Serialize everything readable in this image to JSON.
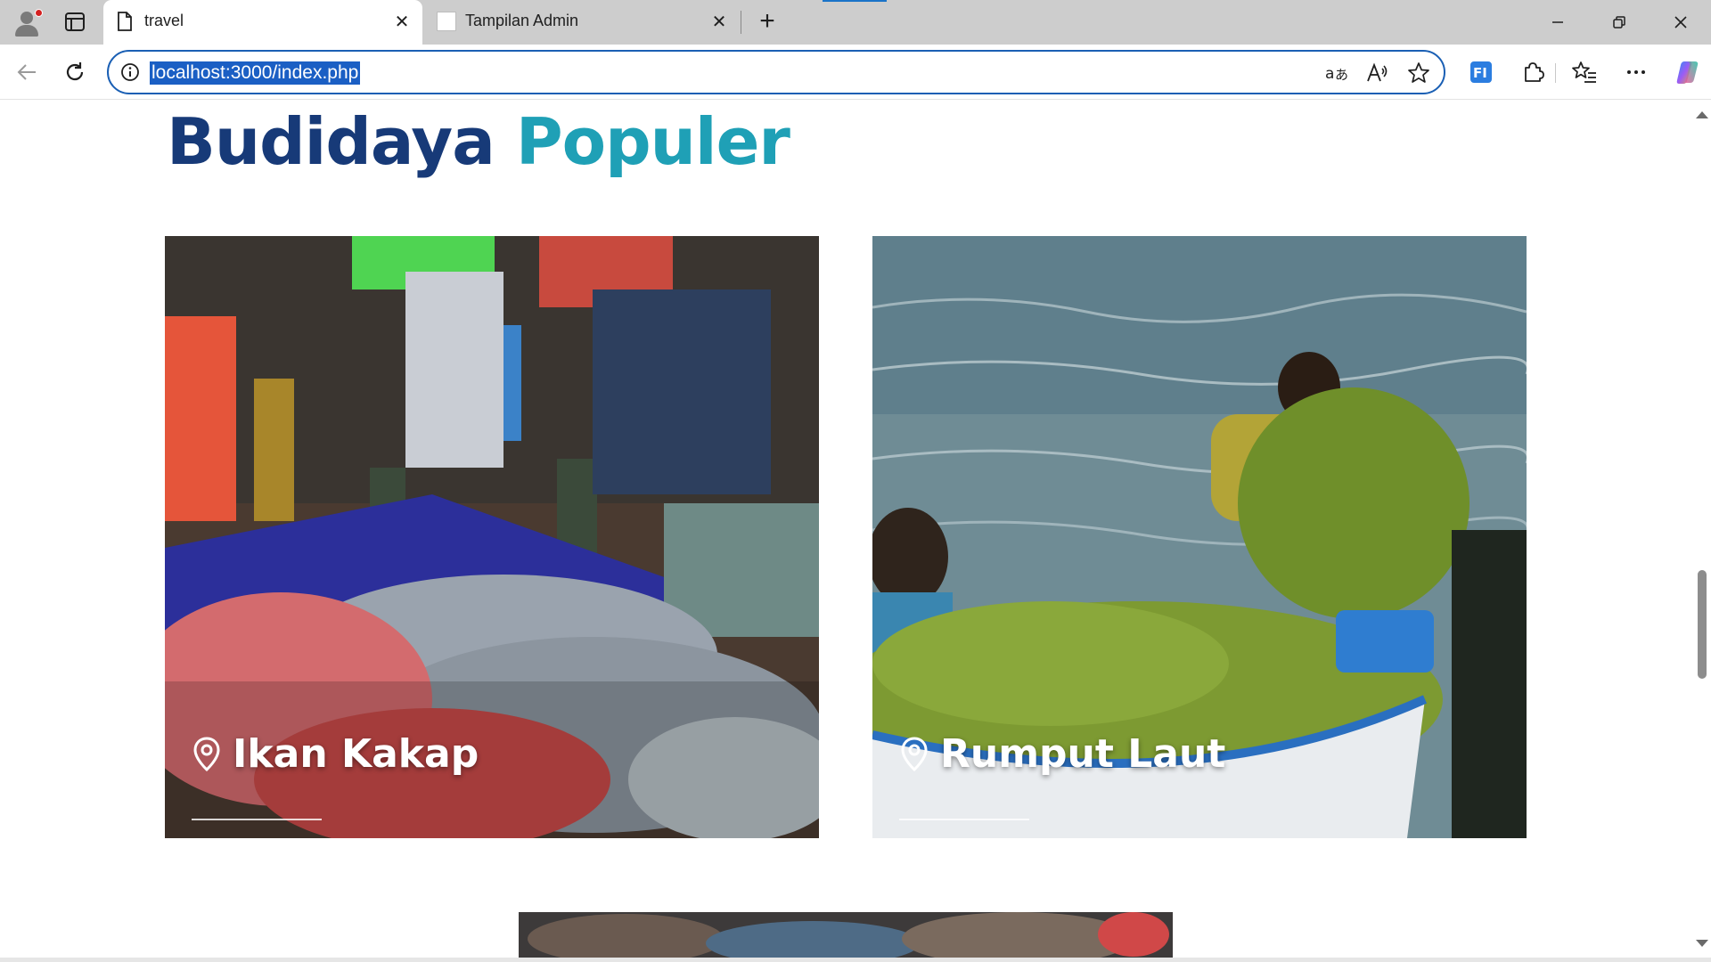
{
  "browser": {
    "tabs": [
      {
        "title": "travel",
        "active": true,
        "favicon": "document-icon"
      },
      {
        "title": "Tampilan Admin",
        "active": false,
        "favicon": "blank-page-icon"
      }
    ],
    "address": {
      "url": "localhost:3000/index.php"
    },
    "accent_color": "#1a5fb4"
  },
  "page": {
    "heading": {
      "word1": "Budidaya",
      "word2": "Populer",
      "color1": "#173a78",
      "color2": "#1fa0b6"
    },
    "cards": [
      {
        "title": "Ikan Kakap",
        "icon": "map-pin-icon",
        "image": "fish-market-photo"
      },
      {
        "title": "Rumput Laut",
        "icon": "map-pin-icon",
        "image": "seaweed-boat-photo"
      }
    ],
    "partial_card": {
      "image": "lobster-photo"
    }
  }
}
